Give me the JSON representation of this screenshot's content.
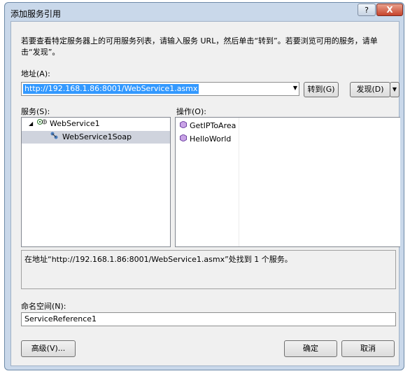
{
  "window": {
    "title": "添加服务引用",
    "help_button": "?",
    "close_button": "X"
  },
  "instructions": "若要查看特定服务器上的可用服务列表，请输入服务 URL，然后单击“转到”。若要浏览可用的服务，请单击“发现”。",
  "address": {
    "label": "地址(A):",
    "value": "http://192.168.1.86:8001/WebService1.asmx",
    "go_button": "转到(G)",
    "discover_button": "发现(D)"
  },
  "services": {
    "label": "服务(S):",
    "tree": [
      {
        "label": "WebService1",
        "expanded": true
      },
      {
        "label": "WebService1Soap",
        "selected": true
      }
    ]
  },
  "operations": {
    "label": "操作(O):",
    "items": [
      "GetIPToArea",
      "HelloWorld"
    ]
  },
  "status_message": "在地址“http://192.168.1.86:8001/WebService1.asmx”处找到 1 个服务。",
  "namespace": {
    "label": "命名空间(N):",
    "value": "ServiceReference1"
  },
  "buttons": {
    "advanced": "高级(V)...",
    "ok": "确定",
    "cancel": "取消"
  },
  "colors": {
    "selection": "#3399ff",
    "window_frame": "#c9d8ea",
    "tree_selected": "#cfd3dd"
  }
}
